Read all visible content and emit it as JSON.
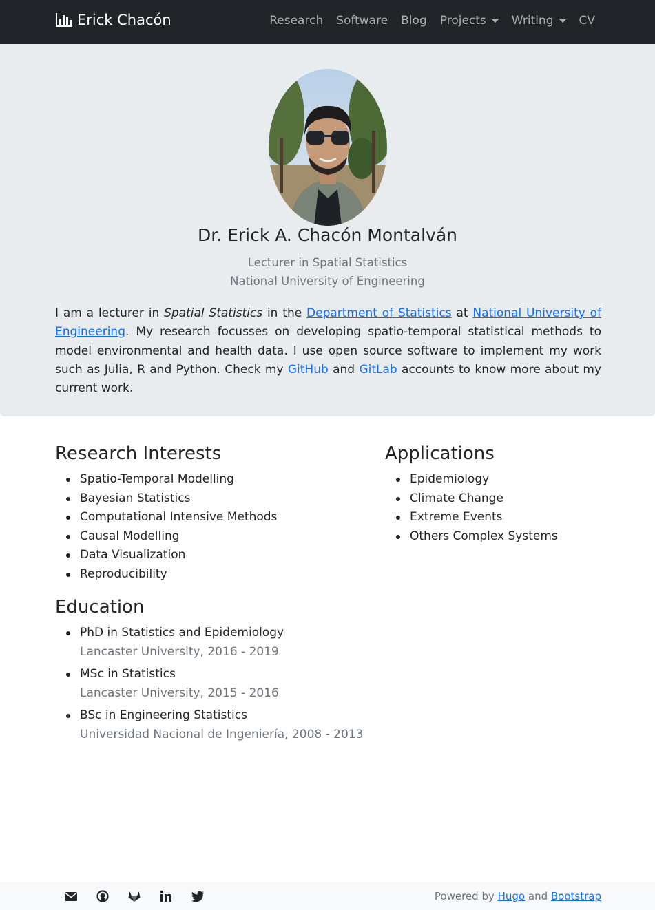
{
  "navbar": {
    "brand": "Erick Chacón",
    "items": [
      {
        "label": "Research"
      },
      {
        "label": "Software"
      },
      {
        "label": "Blog"
      },
      {
        "label": "Projects"
      },
      {
        "label": "Writing"
      },
      {
        "label": "CV"
      }
    ]
  },
  "hero": {
    "name": "Dr. Erick A. Chacón Montalván",
    "role": "Lecturer in Spatial Statistics",
    "institution": "National University of Engineering",
    "bio": {
      "t1": "I am a lecturer in ",
      "em": "Spatial Statistics",
      "t2": " in the ",
      "link_dept": "Department of Statistics",
      "t3": " at ",
      "link_uni": "National University of Engineering",
      "t4": ". My research focusses on developing spatio-temporal statistical methods to model environmental and health data. I use open source software to implement my work such as Julia, R and Python. Check my ",
      "link_github": "GitHub",
      "t5": " and ",
      "link_gitlab": "GitLab",
      "t6": " accounts to know more about my current work."
    }
  },
  "research": {
    "title": "Research Interests",
    "items": [
      "Spatio-Temporal Modelling",
      "Bayesian Statistics",
      "Computational Intensive Methods",
      "Causal Modelling",
      "Data Visualization",
      "Reproducibility"
    ]
  },
  "applications": {
    "title": "Applications",
    "items": [
      "Epidemiology",
      "Climate Change",
      "Extreme Events",
      "Others Complex Systems"
    ]
  },
  "education": {
    "title": "Education",
    "items": [
      {
        "degree": "PhD in Statistics and Epidemiology",
        "detail": "Lancaster University, 2016 - 2019"
      },
      {
        "degree": "MSc in Statistics",
        "detail": "Lancaster University, 2015 - 2016"
      },
      {
        "degree": "BSc in Engineering Statistics",
        "detail": "Universidad Nacional de Ingeniería, 2008 - 2013"
      }
    ]
  },
  "footer": {
    "social_icons": [
      "envelope-icon",
      "github-icon",
      "gitlab-icon",
      "linkedin-icon",
      "twitter-icon"
    ],
    "powered_prefix": "Powered by ",
    "hugo": "Hugo",
    "and": " and ",
    "bootstrap": "Bootstrap"
  },
  "colors": {
    "navbar_bg": "#212529",
    "hero_bg": "#e9ecef",
    "link": "#0d6efd",
    "muted": "#6c757d"
  }
}
